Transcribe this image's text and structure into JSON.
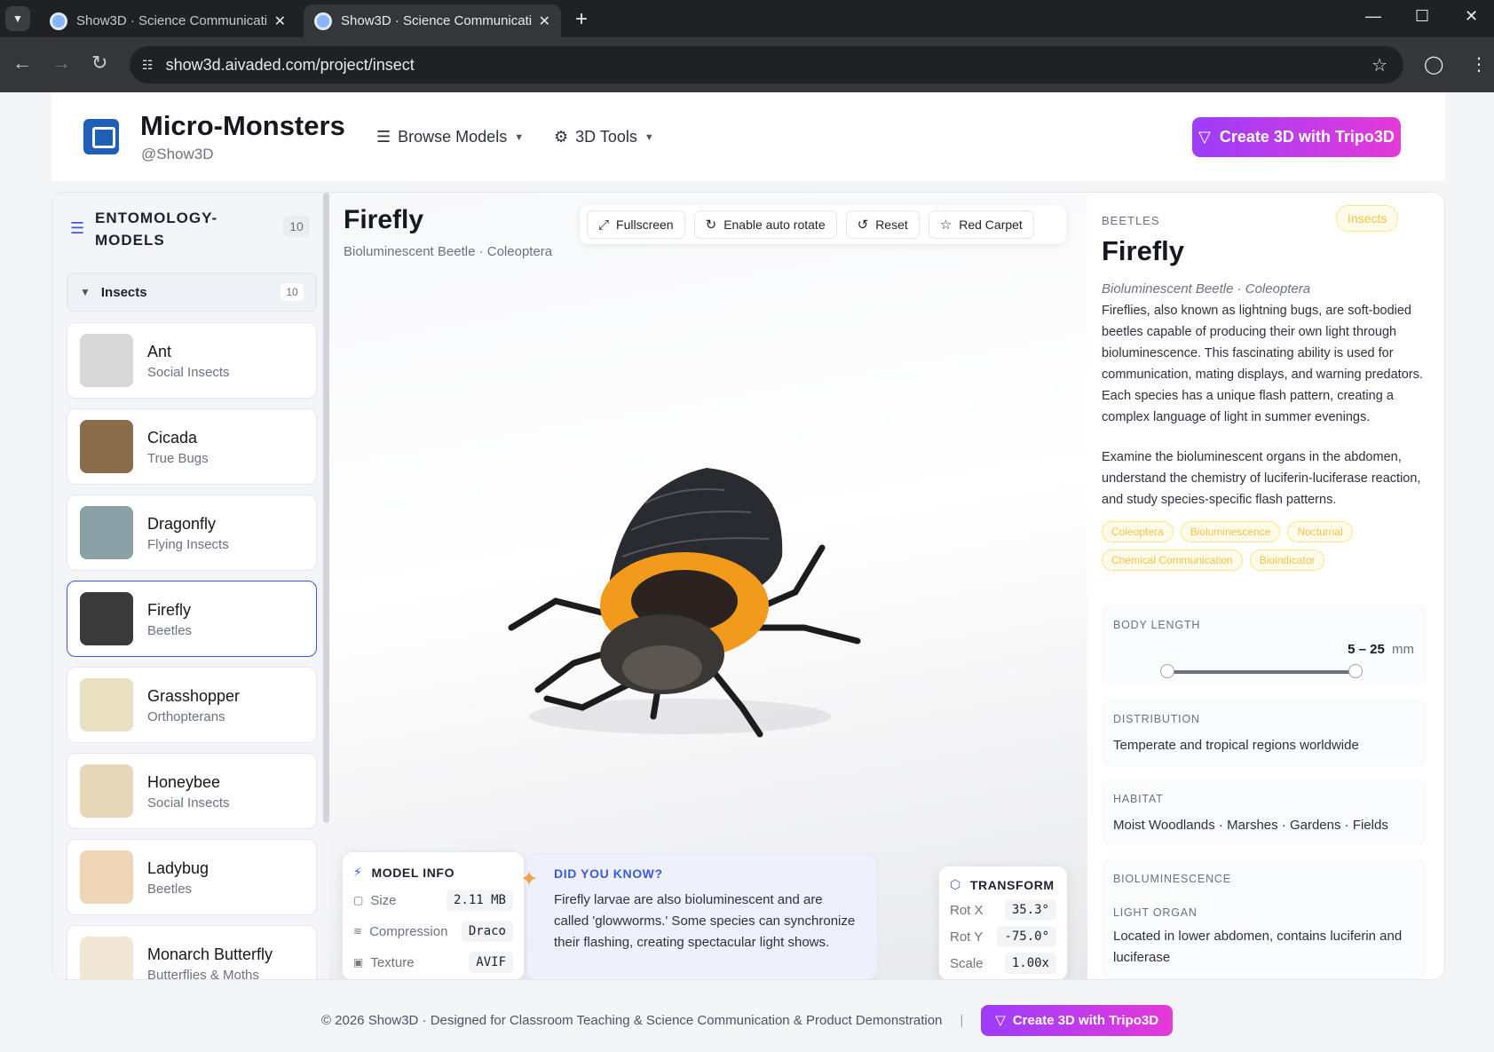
{
  "browser": {
    "tabs": [
      {
        "title": "Show3D · Science Communicati",
        "active": false
      },
      {
        "title": "Show3D · Science Communicati",
        "active": true
      }
    ],
    "url": "show3d.aivaded.com/project/insect"
  },
  "header": {
    "title": "Micro-Monsters",
    "subtitle": "@Show3D",
    "nav": [
      {
        "label": "Browse Models",
        "icon": "database-icon"
      },
      {
        "label": "3D Tools",
        "icon": "gear-icon"
      }
    ],
    "cta_label": "Create 3D with Tripo3D"
  },
  "sidebar": {
    "title": "ENTOMOLOGY-MODELS",
    "count": "10",
    "group": {
      "label": "Insects",
      "count": "10"
    },
    "items": [
      {
        "name": "Ant",
        "category": "Social Insects",
        "thumb_color": "#d8d8d8"
      },
      {
        "name": "Cicada",
        "category": "True Bugs",
        "thumb_color": "#8a6b4a"
      },
      {
        "name": "Dragonfly",
        "category": "Flying Insects",
        "thumb_color": "#8aa0a8"
      },
      {
        "name": "Firefly",
        "category": "Beetles",
        "thumb_color": "#3a3a3a"
      },
      {
        "name": "Grasshopper",
        "category": "Orthopterans",
        "thumb_color": "#e8e0c0"
      },
      {
        "name": "Honeybee",
        "category": "Social Insects",
        "thumb_color": "#e6d7b8"
      },
      {
        "name": "Ladybug",
        "category": "Beetles",
        "thumb_color": "#f0d6b8"
      },
      {
        "name": "Monarch Butterfly",
        "category": "Butterflies & Moths",
        "thumb_color": "#f2e6d6"
      }
    ],
    "selected_index": 3
  },
  "viewer": {
    "title": "Firefly",
    "subtitle": "Bioluminescent Beetle · Coleoptera",
    "controls": [
      {
        "label": "Fullscreen",
        "icon": "expand-icon"
      },
      {
        "label": "Enable auto rotate",
        "icon": "rotate-icon"
      },
      {
        "label": "Reset",
        "icon": "reset-icon"
      },
      {
        "label": "Red Carpet",
        "icon": "star-icon"
      }
    ],
    "model_info": {
      "title": "MODEL INFO",
      "rows": [
        {
          "key": "Size",
          "value": "2.11 MB",
          "icon": "file-icon"
        },
        {
          "key": "Compression",
          "value": "Draco",
          "icon": "layers-icon"
        },
        {
          "key": "Texture",
          "value": "AVIF",
          "icon": "image-icon"
        }
      ]
    },
    "did_you_know": {
      "title": "DID YOU KNOW?",
      "text": "Firefly larvae are also bioluminescent and are called 'glowworms.' Some species can synchronize their flashing, creating spectacular light shows."
    },
    "transform": {
      "title": "TRANSFORM",
      "rows": [
        {
          "key": "Rot X",
          "value": "35.3°"
        },
        {
          "key": "Rot Y",
          "value": "-75.0°"
        },
        {
          "key": "Scale",
          "value": "1.00x"
        }
      ]
    }
  },
  "detail": {
    "category": "BEETLES",
    "badge": "Insects",
    "title": "Firefly",
    "scientific": "Bioluminescent Beetle · Coleoptera",
    "description_1": "Fireflies, also known as lightning bugs, are soft-bodied beetles capable of producing their own light through bioluminescence. This fascinating ability is used for communication, mating displays, and warning predators. Each species has a unique flash pattern, creating a complex language of light in summer evenings.",
    "description_2": "Examine the bioluminescent organs in the abdomen, understand the chemistry of luciferin-luciferase reaction, and study species-specific flash patterns.",
    "tags": [
      "Coleoptera",
      "Bioluminescence",
      "Nocturnal",
      "Chemical Communication",
      "Bioindicator"
    ],
    "body_length": {
      "label": "BODY LENGTH",
      "min": "5",
      "dash": "–",
      "max": "25",
      "unit": "mm"
    },
    "distribution": {
      "label": "DISTRIBUTION",
      "value": "Temperate and tropical regions worldwide"
    },
    "habitat": {
      "label": "HABITAT",
      "value": "Moist Woodlands · Marshes · Gardens · Fields"
    },
    "bioluminescence": {
      "label": "BIOLUMINESCENCE",
      "sub_label": "LIGHT ORGAN",
      "value": "Located in lower abdomen, contains luciferin and luciferase"
    }
  },
  "footer": {
    "text": "© 2026 Show3D · Designed for Classroom Teaching & Science Communication & Product Demonstration",
    "separator": "|",
    "cta_label": "Create 3D with Tripo3D"
  },
  "colors": {
    "accent": "#3b5bdb",
    "cta_start": "#9c3dfa",
    "cta_end": "#e43ad8",
    "tag": "#f5c342"
  }
}
